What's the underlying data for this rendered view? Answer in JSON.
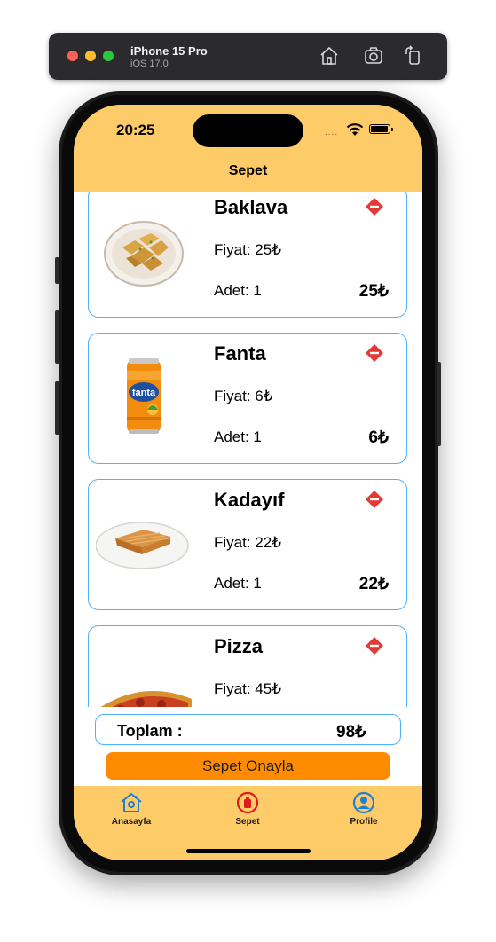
{
  "simulator": {
    "device": "iPhone 15 Pro",
    "os": "iOS 17.0",
    "icons": [
      "home-icon",
      "screenshot-icon",
      "rotate-icon"
    ]
  },
  "status_bar": {
    "time": "20:25",
    "signal": "....",
    "icons": [
      "wifi-icon",
      "battery-icon"
    ]
  },
  "nav": {
    "title": "Sepet"
  },
  "cart": {
    "items": [
      {
        "name": "Baklava",
        "price": "Fiyat: 25₺",
        "qty": "Adet: 1",
        "total": "25₺",
        "image": "baklava-plate"
      },
      {
        "name": "Fanta",
        "price": "Fiyat: 6₺",
        "qty": "Adet: 1",
        "total": "6₺",
        "image": "fanta-can"
      },
      {
        "name": "Kadayıf",
        "price": "Fiyat: 22₺",
        "qty": "Adet: 1",
        "total": "22₺",
        "image": "kadayif-plate"
      },
      {
        "name": "Pizza",
        "price": "Fiyat: 45₺",
        "qty": "",
        "total": "",
        "image": "pizza"
      }
    ]
  },
  "summary": {
    "label": "Toplam :",
    "value": "98₺"
  },
  "confirm_button": {
    "label": "Sepet Onayla"
  },
  "tabs": [
    {
      "label": "Anasayfa",
      "icon": "house-icon",
      "color": "#1e7fd6"
    },
    {
      "label": "Sepet",
      "icon": "cart-badge-icon",
      "color": "#e01b1b"
    },
    {
      "label": "Profile",
      "icon": "person-circle-icon",
      "color": "#1e7fd6"
    }
  ],
  "colors": {
    "header_bg": "#fecb69",
    "card_border": "#4fb2ff",
    "confirm_bg": "#ff8c00",
    "delete_red": "#e53935"
  }
}
